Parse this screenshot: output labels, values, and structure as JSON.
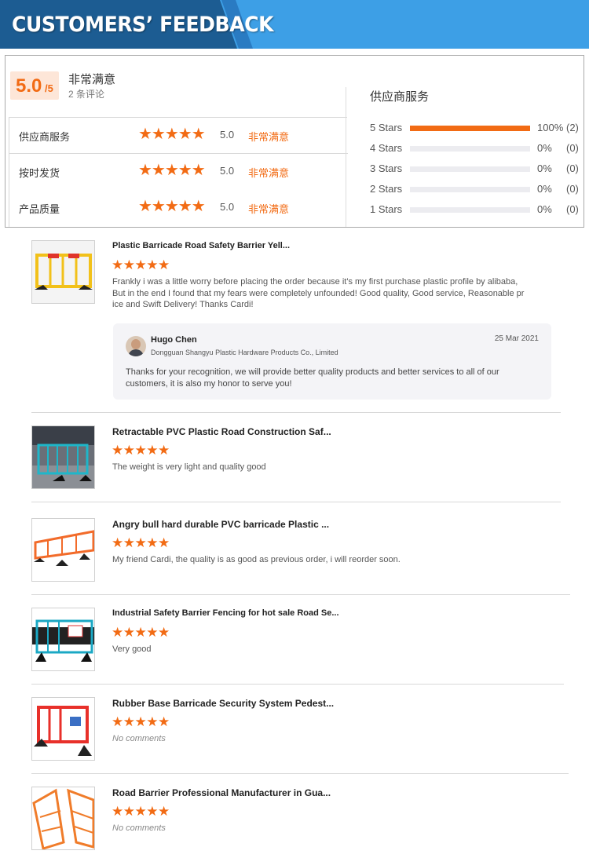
{
  "banner": {
    "title": "CUSTOMERS’ FEEDBACK"
  },
  "summary": {
    "score": "5.0",
    "score_max": "/5",
    "overall_label": "非常满意",
    "review_count": "2 条评论",
    "categories": [
      {
        "label": "供应商服务",
        "stars": "★★★★★",
        "rating": 5.0,
        "value": "5.0",
        "satisfaction": "非常满意"
      },
      {
        "label": "按时发货",
        "stars": "★★★★★",
        "rating": 5.0,
        "value": "5.0",
        "satisfaction": "非常满意"
      },
      {
        "label": "产品质量",
        "stars": "★★★★★",
        "rating": 5.0,
        "value": "5.0",
        "satisfaction": "非常满意"
      }
    ],
    "distribution_title": "供应商服务",
    "distribution": [
      {
        "label": "5 Stars",
        "fraction": 1.0,
        "percent": "100%",
        "count": "(2)"
      },
      {
        "label": "4 Stars",
        "fraction": 0,
        "percent": "0%",
        "count": "(0)"
      },
      {
        "label": "3 Stars",
        "fraction": 0,
        "percent": "0%",
        "count": "(0)"
      },
      {
        "label": "2 Stars",
        "fraction": 0,
        "percent": "0%",
        "count": "(0)"
      },
      {
        "label": "1 Stars",
        "fraction": 0,
        "percent": "0%",
        "count": "(0)"
      }
    ]
  },
  "colors": {
    "accent": "#f26b14",
    "banner_dark": "#1c5c92",
    "banner_light": "#3d9fe6"
  },
  "reviews": [
    {
      "product": "Plastic Barricade Road Safety Barrier Yell...",
      "stars": "★★★★★",
      "rating": 5,
      "comment_lines": [
        "Frankly i was a little worry before placing the order because it's my first purchase plastic profile by alibaba,",
        "But in the end I found that my fears were completely unfounded! Good quality, Good service, Reasonable pr",
        "ice and Swift Delivery! Thanks Cardi!"
      ],
      "thumb_icon": "yellow-barrier-icon",
      "reply": {
        "name": "Hugo Chen",
        "company": "Dongguan Shangyu Plastic Hardware Products Co., Limited",
        "date": "25 Mar 2021",
        "text_lines": [
          "Thanks for your recognition, we will provide better quality products and better services to all of our",
          "customers, it is also my honor to serve you!"
        ]
      }
    },
    {
      "product": "Retractable PVC Plastic Road Construction Saf...",
      "stars": "★★★★★",
      "rating": 5,
      "comment": "The weight is very light and quality good",
      "thumb_icon": "blue-barrier-icon"
    },
    {
      "product": "Angry bull hard durable PVC barricade Plastic ...",
      "stars": "★★★★★",
      "rating": 5,
      "comment": "My friend Cardi, the quality is as good as previous order, i will reorder soon.",
      "thumb_icon": "orange-barrier-row-icon"
    },
    {
      "product": "Industrial Safety Barrier Fencing for hot sale Road Se...",
      "stars": "★★★★★",
      "rating": 5,
      "comment": "Very good",
      "thumb_icon": "teal-barrier-icon"
    },
    {
      "product": "Rubber Base Barricade Security System Pedest...",
      "stars": "★★★★★",
      "rating": 5,
      "comment": "No comments",
      "thumb_icon": "red-barrier-icon"
    },
    {
      "product": "Road Barrier Professional Manufacturer in Gua...",
      "stars": "★★★★★",
      "rating": 5,
      "comment": "No comments",
      "thumb_icon": "orange-barrier-diagonal-icon"
    }
  ]
}
